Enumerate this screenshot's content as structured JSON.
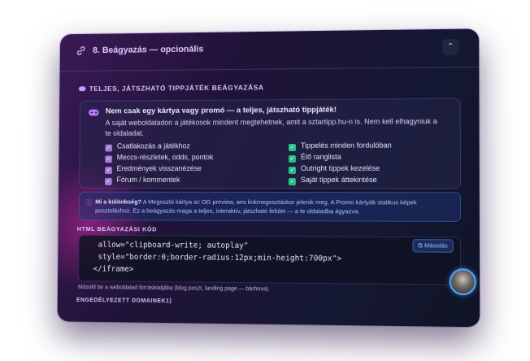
{
  "section": {
    "title": "8. Beágyazás — opcionális",
    "collapse_icon": "chevron-up-icon"
  },
  "embed": {
    "heading": "TELJES, JÁTSZHATÓ TIPPJÁTÉK BEÁGYAZÁSA",
    "box_title": "Nem csak egy kártya vagy promó — a teljes, játszható tippjáték!",
    "box_desc": "A saját weboldaladon a játékosok mindent megtehetnek, amit a sztartipp.hu-n is. Nem kell elhagyniuk a te oldaladat.",
    "features_left": [
      "Csatlakozás a játékhoz",
      "Meccs-részletek, odds, pontok",
      "Eredmények visszanézése",
      "Fórum / kommentek"
    ],
    "features_right": [
      "Tippelés minden fordulóban",
      "Élő ranglista",
      "Outright tippek kezelése",
      "Saját tippek áttekintése"
    ],
    "colors": {
      "left_check": "#a678dc",
      "right_check": "#26c08a"
    }
  },
  "info": {
    "label": "Mi a különbség?",
    "text": "A Megosztó kártya az OG preview, ami linkmegosztáskor jelenik meg. A Promo kártyák statikus képek posztoláshoz. Ez a beágyazás maga a teljes, interaktív, játszható felület — a te oldaladba ágyazva."
  },
  "code": {
    "heading": "HTML BEÁGYAZÁSI KÓD",
    "lines": [
      "allow=\"clipboard-write; autoplay\"",
      "style=\"border:0;border-radius:12px;min-height:700px\">",
      "</iframe>"
    ],
    "copy_label": "Másolás",
    "hint": "Másold be a weboldalad forráskódjába (blog poszt, landing page — bárhova)."
  },
  "domains": {
    "heading": "ENGEDÉLYEZETT DOMAINEK1)"
  }
}
